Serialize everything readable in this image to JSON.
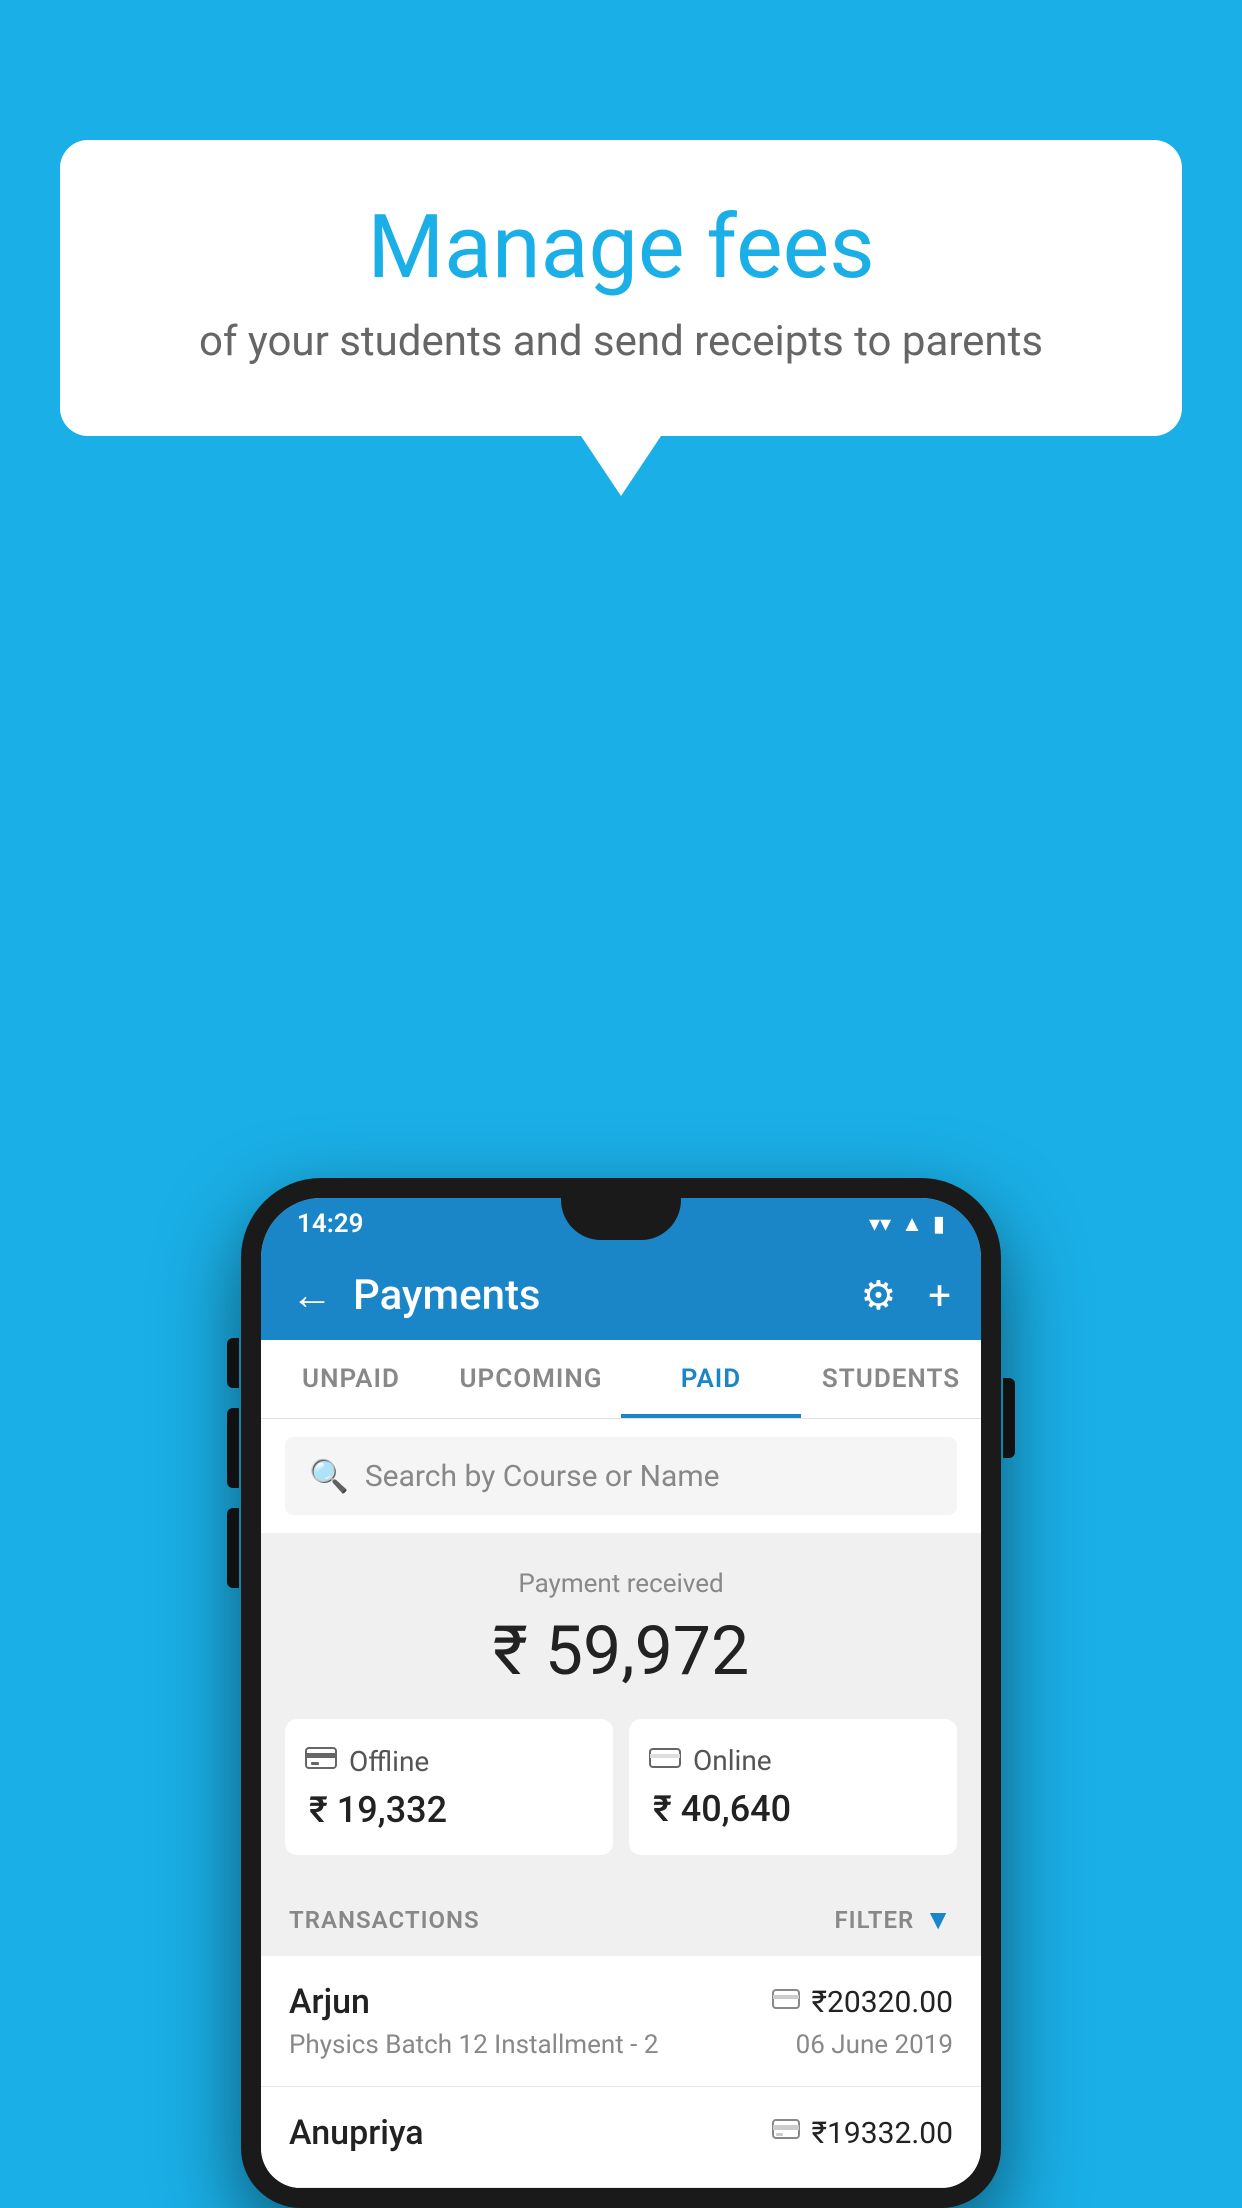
{
  "background_color": "#1AAFE6",
  "speech_bubble": {
    "title": "Manage fees",
    "subtitle": "of your students and send receipts to parents"
  },
  "status_bar": {
    "time": "14:29",
    "wifi": "▼",
    "signal": "▲",
    "battery": "▮"
  },
  "app_bar": {
    "title": "Payments",
    "back_icon": "←",
    "settings_icon": "⚙",
    "add_icon": "+"
  },
  "tabs": [
    {
      "label": "UNPAID",
      "active": false
    },
    {
      "label": "UPCOMING",
      "active": false
    },
    {
      "label": "PAID",
      "active": true
    },
    {
      "label": "STUDENTS",
      "active": false
    }
  ],
  "search": {
    "placeholder": "Search by Course or Name"
  },
  "payment_received": {
    "label": "Payment received",
    "amount": "₹ 59,972",
    "offline": {
      "label": "Offline",
      "amount": "₹ 19,332"
    },
    "online": {
      "label": "Online",
      "amount": "₹ 40,640"
    }
  },
  "transactions_section": {
    "label": "TRANSACTIONS",
    "filter_label": "FILTER"
  },
  "transactions": [
    {
      "name": "Arjun",
      "course": "Physics Batch 12 Installment - 2",
      "amount": "₹20320.00",
      "date": "06 June 2019",
      "type": "online"
    },
    {
      "name": "Anupriya",
      "course": "",
      "amount": "₹19332.00",
      "date": "",
      "type": "offline"
    }
  ]
}
